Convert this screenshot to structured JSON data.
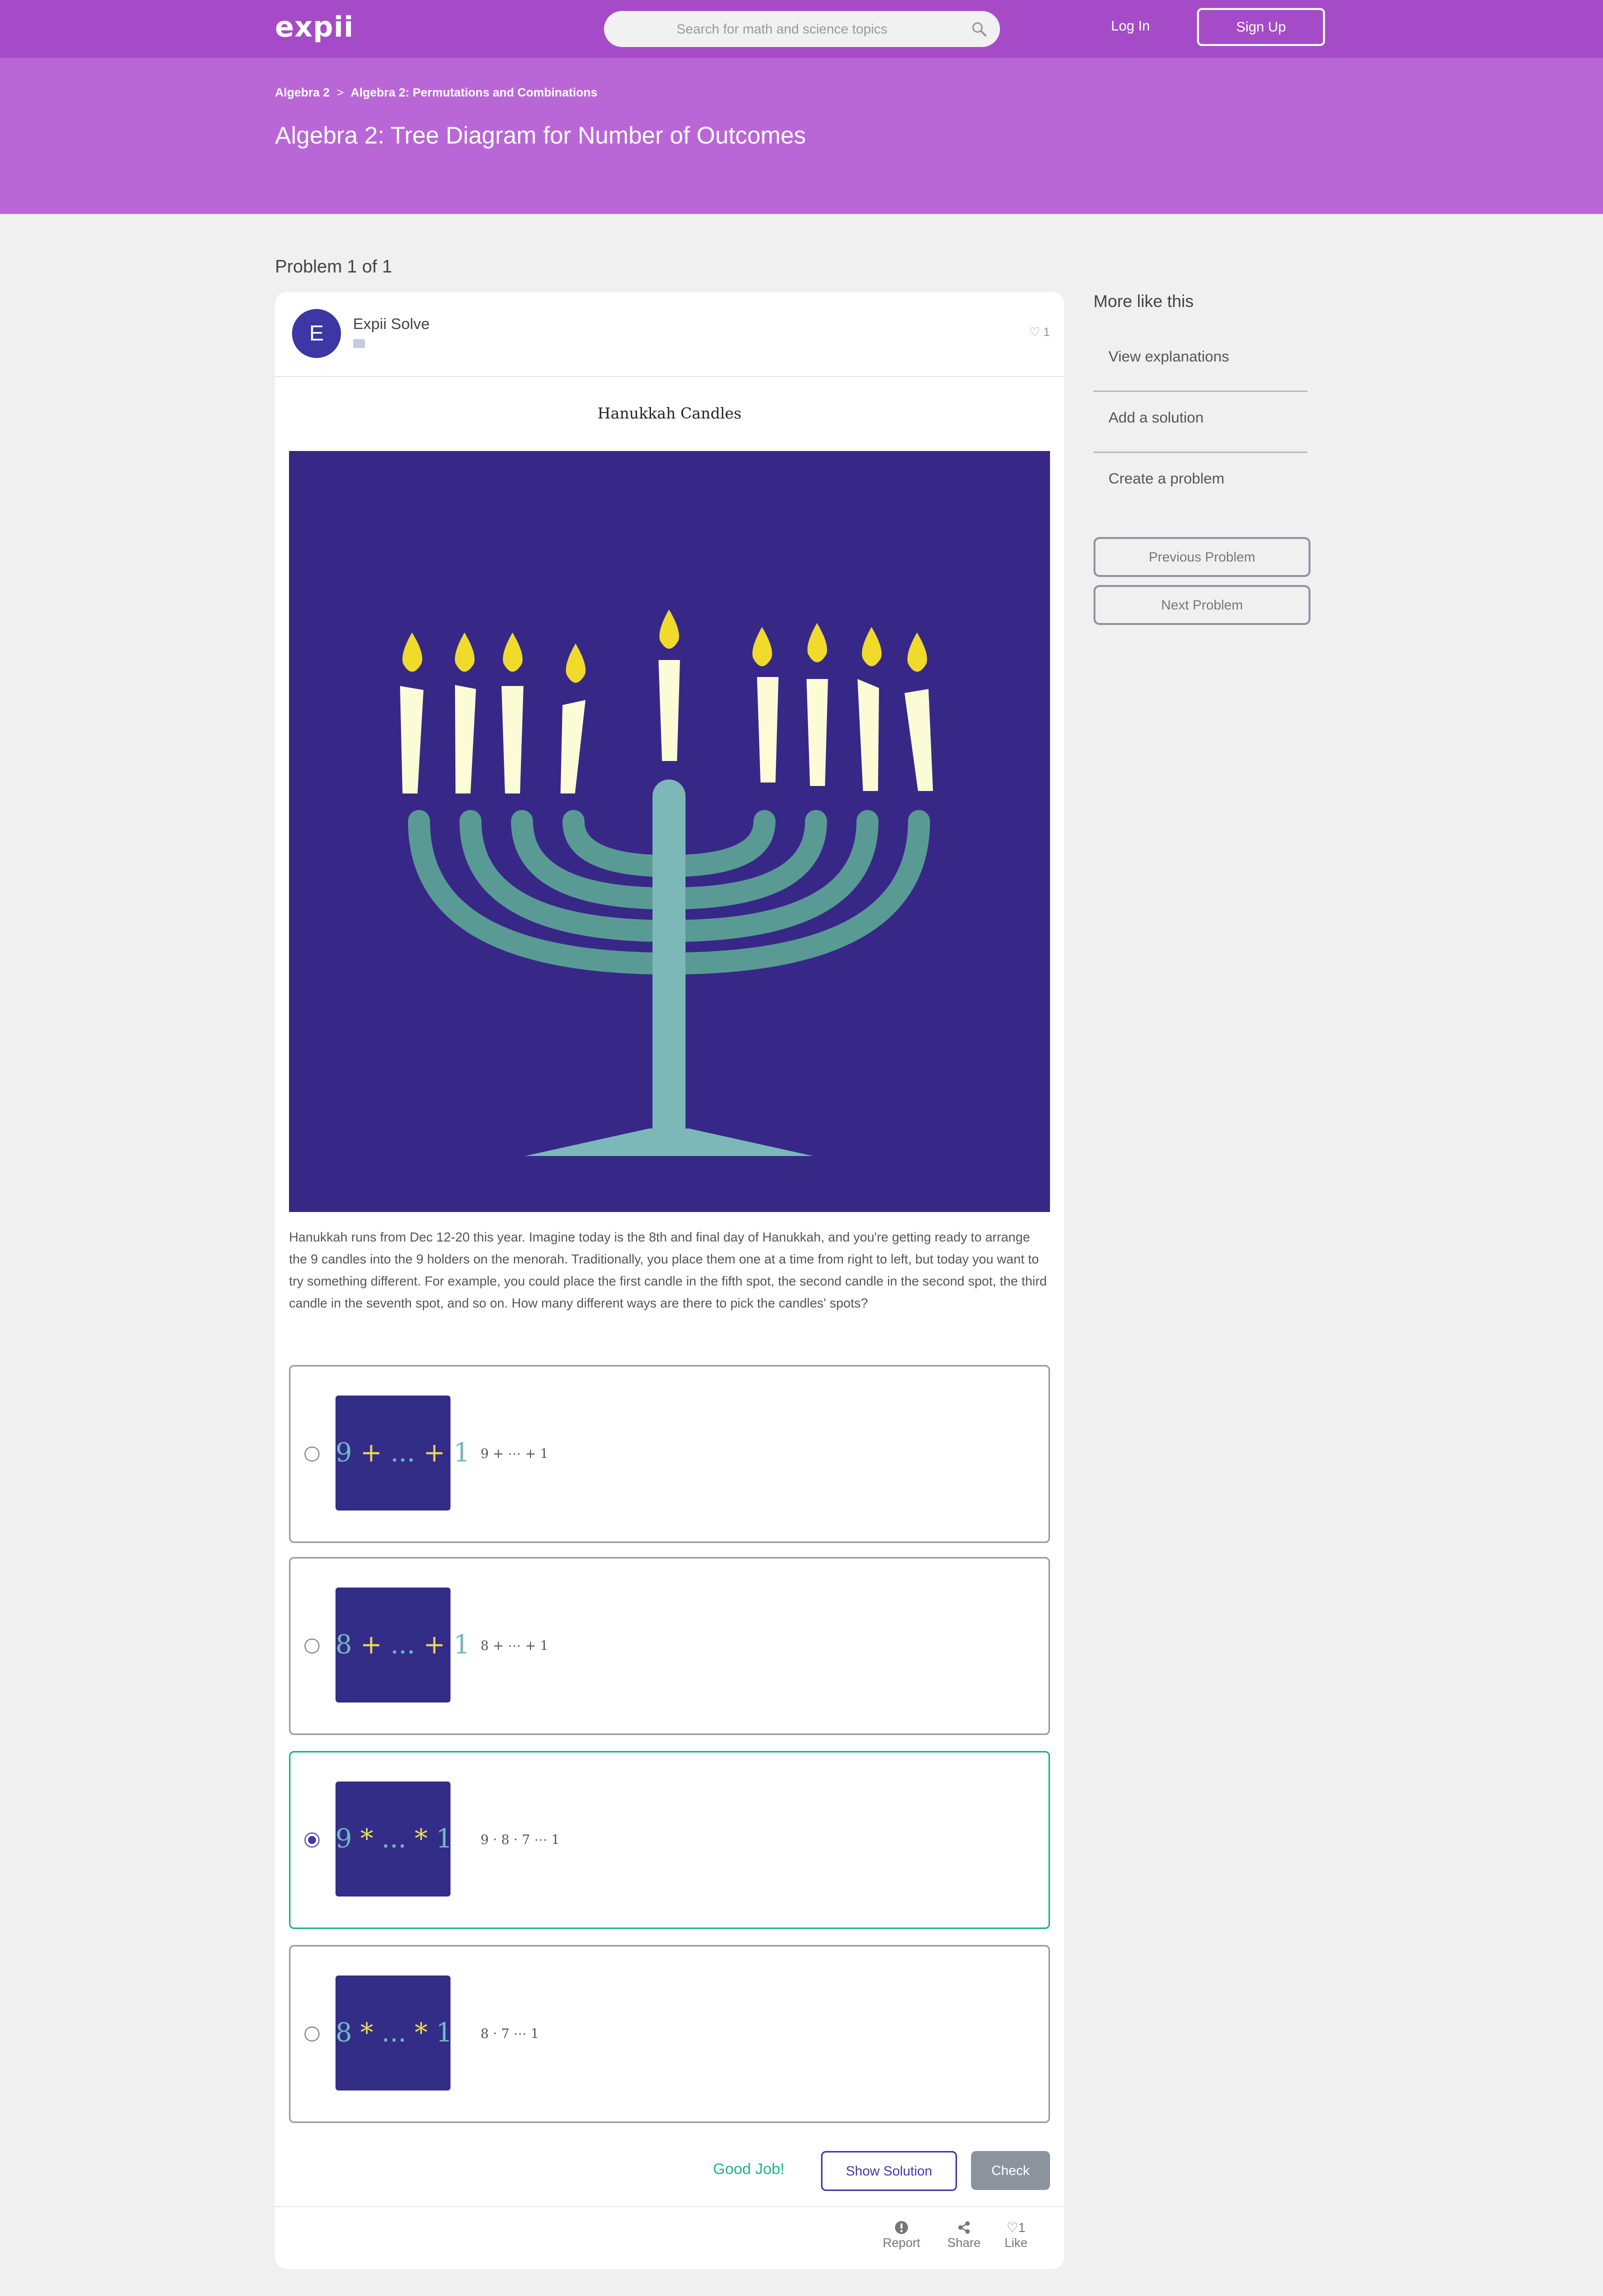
{
  "header": {
    "logo": "expii",
    "search_placeholder": "Search for math and science topics",
    "login_label": "Log In",
    "signup_label": "Sign Up"
  },
  "hero": {
    "breadcrumb": [
      "Algebra 2",
      "Algebra 2: Permutations and Combinations"
    ],
    "breadcrumb_separator": ">",
    "title": "Algebra 2: Tree Diagram for Number of Outcomes"
  },
  "problem": {
    "counter": "Problem 1 of 1",
    "author_initial": "E",
    "author_name": "Expii Solve",
    "like_count": "1",
    "figure_title": "Hanukkah Candles",
    "question": "Hanukkah runs from Dec 12-20 this year. Imagine today is the 8th and final day of Hanukkah, and you're getting ready to arrange the 9 candles into the 9 holders on the menorah. Traditionally, you place them one at a time from right to left, but today you want to try something different. For example, you could place the first candle in the fifth spot, the second candle in the second spot, the third candle in the seventh spot, and so on. How many different ways are there to pick the candles' spots?",
    "options": [
      {
        "thumb_a": "9",
        "thumb_op1": "+",
        "thumb_dots": "...",
        "thumb_op2": "+",
        "thumb_b": "1",
        "label": "9 + ⋯ + 1",
        "selected": false
      },
      {
        "thumb_a": "8",
        "thumb_op1": "+",
        "thumb_dots": "...",
        "thumb_op2": "+",
        "thumb_b": "1",
        "label": "8 + ⋯ + 1",
        "selected": false
      },
      {
        "thumb_a": "9",
        "thumb_op1": "*",
        "thumb_dots": "...",
        "thumb_op2": "*",
        "thumb_b": "1",
        "label": "9 · 8 · 7 ⋯ 1",
        "selected": true
      },
      {
        "thumb_a": "8",
        "thumb_op1": "*",
        "thumb_dots": "...",
        "thumb_op2": "*",
        "thumb_b": "1",
        "label": "8 · 7 ⋯ 1",
        "selected": false
      }
    ],
    "feedback": "Good Job!",
    "show_solution_label": "Show Solution",
    "check_label": "Check",
    "footer": {
      "report_label": "Report",
      "share_label": "Share",
      "like_count": "1",
      "like_label": "Like"
    }
  },
  "sidebar": {
    "title": "More like this",
    "links": [
      "View explanations",
      "Add a solution",
      "Create a problem"
    ],
    "previous_label": "Previous Problem",
    "next_label": "Next Problem"
  },
  "colors": {
    "nav": "#a64bc8",
    "hero": "#b967d6",
    "figure_bg": "#372887",
    "success": "#1db68a",
    "accent": "#4437ad"
  }
}
